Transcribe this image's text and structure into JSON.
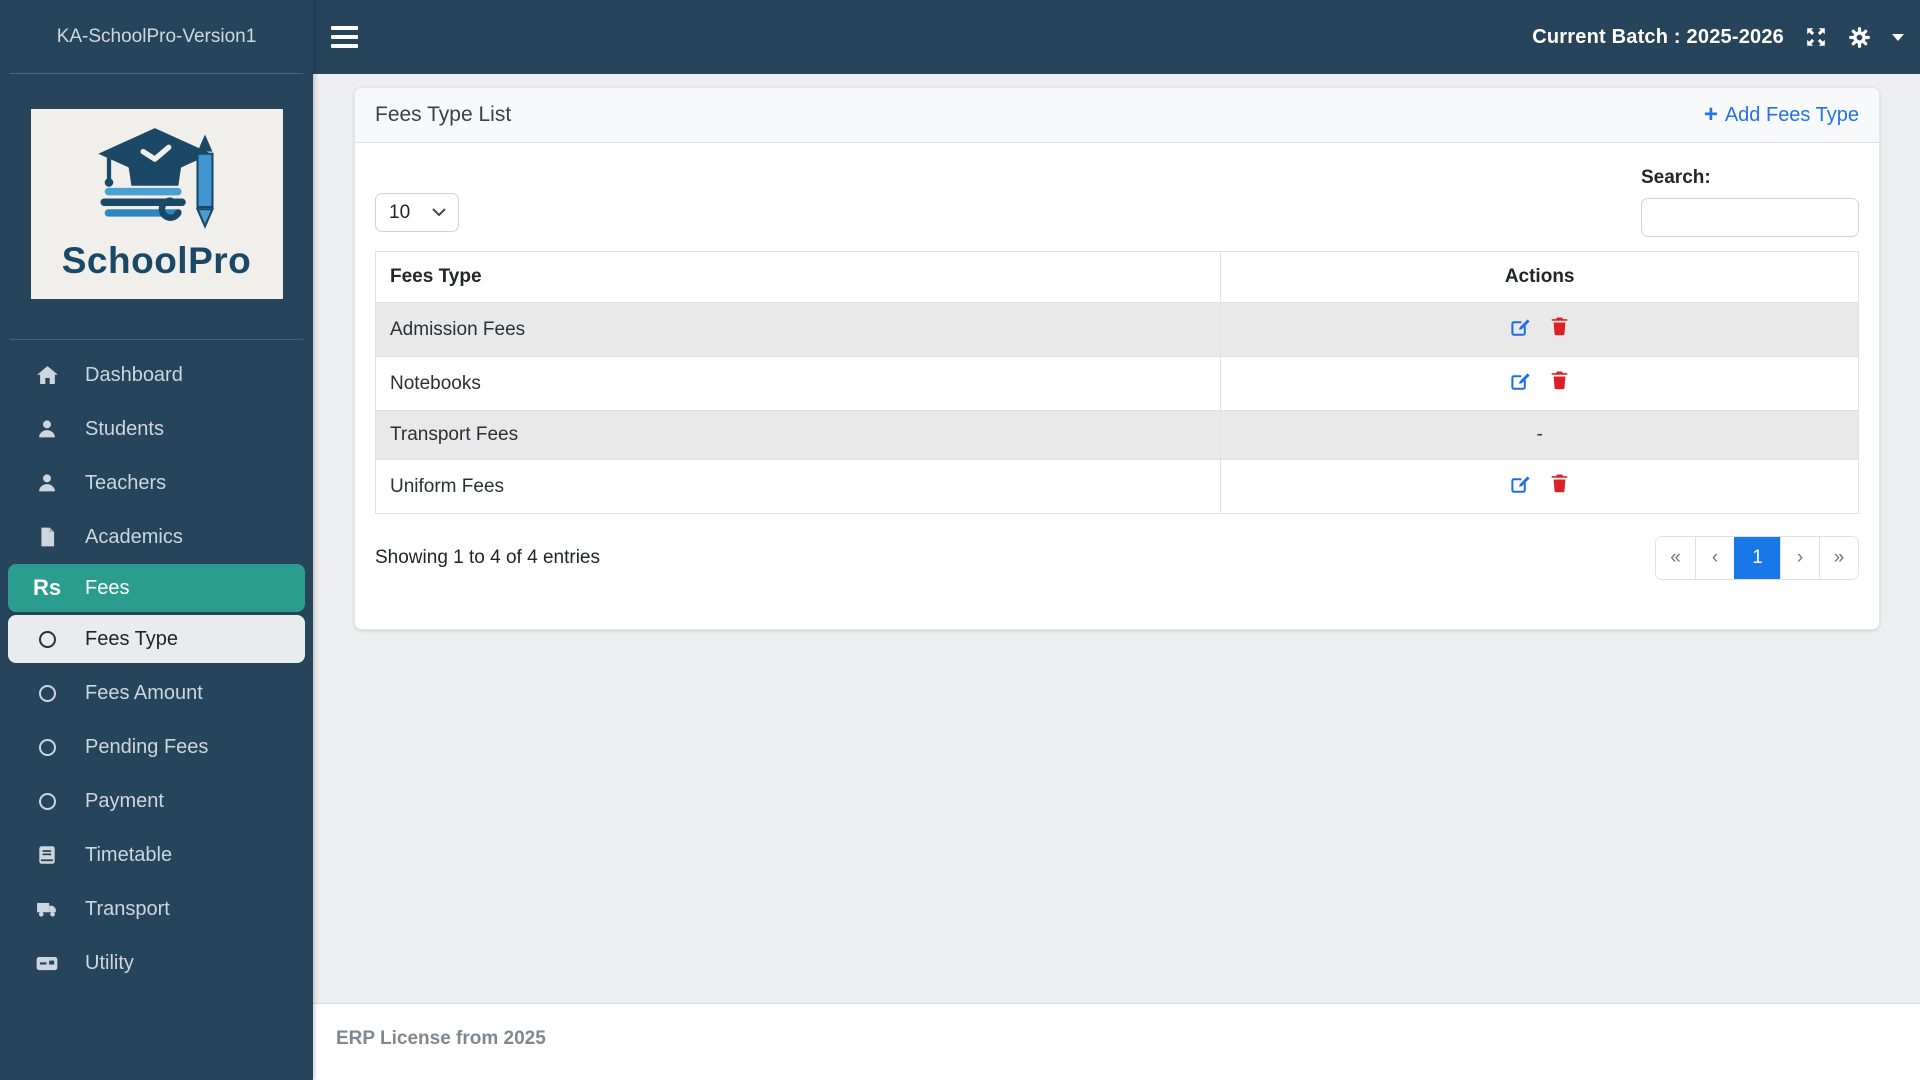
{
  "sidebar": {
    "brand": "KA-SchoolPro-Version1",
    "logo": {
      "name": "SchoolPro",
      "icon": "graduation-cap-books-pencil"
    },
    "items": [
      {
        "label": "Dashboard",
        "icon": "home",
        "active": false
      },
      {
        "label": "Students",
        "icon": "person",
        "active": false
      },
      {
        "label": "Teachers",
        "icon": "person",
        "active": false
      },
      {
        "label": "Academics",
        "icon": "document",
        "active": false
      },
      {
        "label": "Fees",
        "icon": "rupee",
        "icon_text": "Rs",
        "active": true
      },
      {
        "label": "Fees Type",
        "icon": "circle",
        "active": true,
        "sub": true
      },
      {
        "label": "Fees Amount",
        "icon": "circle",
        "active": false,
        "sub": true
      },
      {
        "label": "Pending Fees",
        "icon": "circle",
        "active": false,
        "sub": true
      },
      {
        "label": "Payment",
        "icon": "circle",
        "active": false,
        "sub": true
      },
      {
        "label": "Timetable",
        "icon": "book",
        "active": false
      },
      {
        "label": "Transport",
        "icon": "truck",
        "active": false
      },
      {
        "label": "Utility",
        "icon": "card",
        "active": false
      }
    ]
  },
  "topbar": {
    "menu_icon": "hamburger",
    "current_batch_label": "Current Batch : 2025-2026",
    "icons": [
      "fullscreen",
      "gear",
      "caret-down"
    ]
  },
  "panel": {
    "title": "Fees Type List",
    "add_button": {
      "icon": "plus",
      "plus_glyph": "+",
      "label": "Add Fees Type"
    },
    "length_select": {
      "value": "10"
    },
    "search": {
      "label": "Search:",
      "value": "",
      "placeholder": ""
    },
    "table": {
      "columns": [
        "Fees Type",
        "Actions"
      ],
      "rows": [
        {
          "fees_type": "Admission Fees",
          "has_actions": true
        },
        {
          "fees_type": "Notebooks",
          "has_actions": true
        },
        {
          "fees_type": "Transport Fees",
          "has_actions": false,
          "actions_text": "-"
        },
        {
          "fees_type": "Uniform Fees",
          "has_actions": true
        }
      ]
    },
    "info_text": "Showing 1 to 4 of 4 entries",
    "pagination": {
      "first": "«",
      "previous": "‹",
      "pages": [
        "1"
      ],
      "active_page": "1",
      "next": "›",
      "last": "»"
    }
  },
  "footer": {
    "text": "ERP License from 2025"
  },
  "colors": {
    "sidebar_bg": "#26445a",
    "active_item_bg": "#2a9d8f",
    "active_subitem_bg": "#e9ecef",
    "link_blue": "#2572e8",
    "edit_icon_blue": "#1c6ee8",
    "delete_icon_red": "#dc2227",
    "pagination_active_bg": "#1878e8",
    "striped_row_bg": "#e9e9e9",
    "content_bg": "#edeef0",
    "logo_navy": "#1b4965"
  }
}
